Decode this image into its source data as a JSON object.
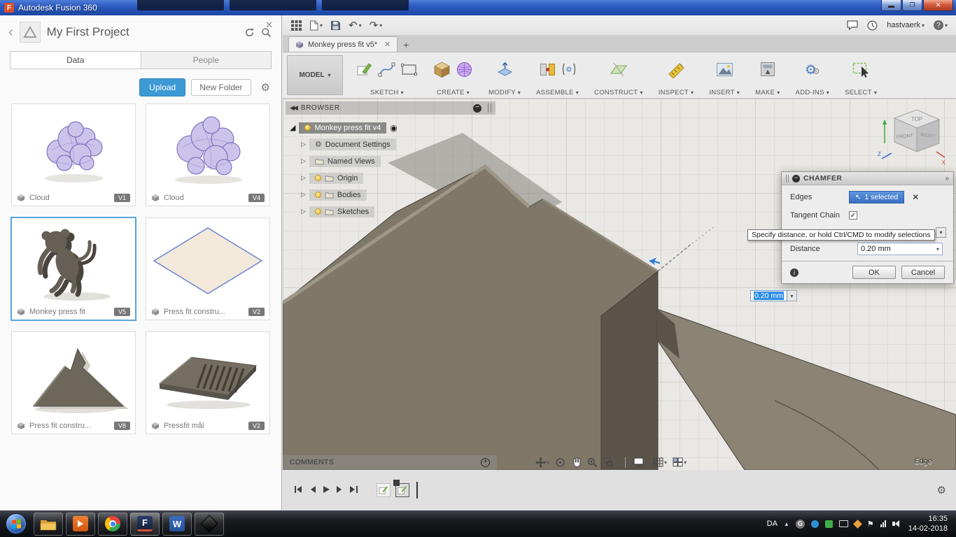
{
  "window": {
    "title": "Autodesk Fusion 360"
  },
  "data_panel": {
    "title": "My First Project",
    "tabs": {
      "data": "Data",
      "people": "People"
    },
    "actions": {
      "upload": "Upload",
      "new_folder": "New Folder"
    },
    "cards": [
      {
        "name": "Cloud",
        "version": "V1"
      },
      {
        "name": "Cloud",
        "version": "V4"
      },
      {
        "name": "Monkey press fit",
        "version": "V5"
      },
      {
        "name": "Press fit constru...",
        "version": "V2"
      },
      {
        "name": "Press fit constru...",
        "version": "V8"
      },
      {
        "name": "Pressfit mål",
        "version": "V2"
      }
    ]
  },
  "qat": {
    "account": "hastvaerk",
    "help": "?"
  },
  "document": {
    "tab_title": "Monkey press fit v5*"
  },
  "ribbon": {
    "workspace": "MODEL",
    "groups": [
      "SKETCH",
      "CREATE",
      "MODIFY",
      "ASSEMBLE",
      "CONSTRUCT",
      "INSPECT",
      "INSERT",
      "MAKE",
      "ADD-INS",
      "SELECT"
    ]
  },
  "browser": {
    "header": "BROWSER",
    "root": "Monkey press fit v4",
    "items": [
      "Document Settings",
      "Named Views",
      "Origin",
      "Bodies",
      "Sketches"
    ]
  },
  "viewport": {
    "comments": "COMMENTS",
    "hint": "Edge"
  },
  "viewcube": {
    "top": "TOP",
    "front": "FRONT",
    "right": "RIGHT",
    "axis_x": "X",
    "axis_z": "Z"
  },
  "chamfer": {
    "title": "CHAMFER",
    "edges_label": "Edges",
    "edges_value": "1 selected",
    "tangent_label": "Tangent Chain",
    "tooltip": "Specify distance, or hold Ctrl/CMD to modify selections",
    "distance_label": "Distance",
    "distance_value": "0.20 mm",
    "inline_value": "0.20 mm",
    "ok": "OK",
    "cancel": "Cancel"
  },
  "taskbar": {
    "language": "DA",
    "time": "16:35",
    "date": "14-02-2018"
  },
  "icons": {
    "fusion_letter": "F",
    "word_letter": "W"
  }
}
